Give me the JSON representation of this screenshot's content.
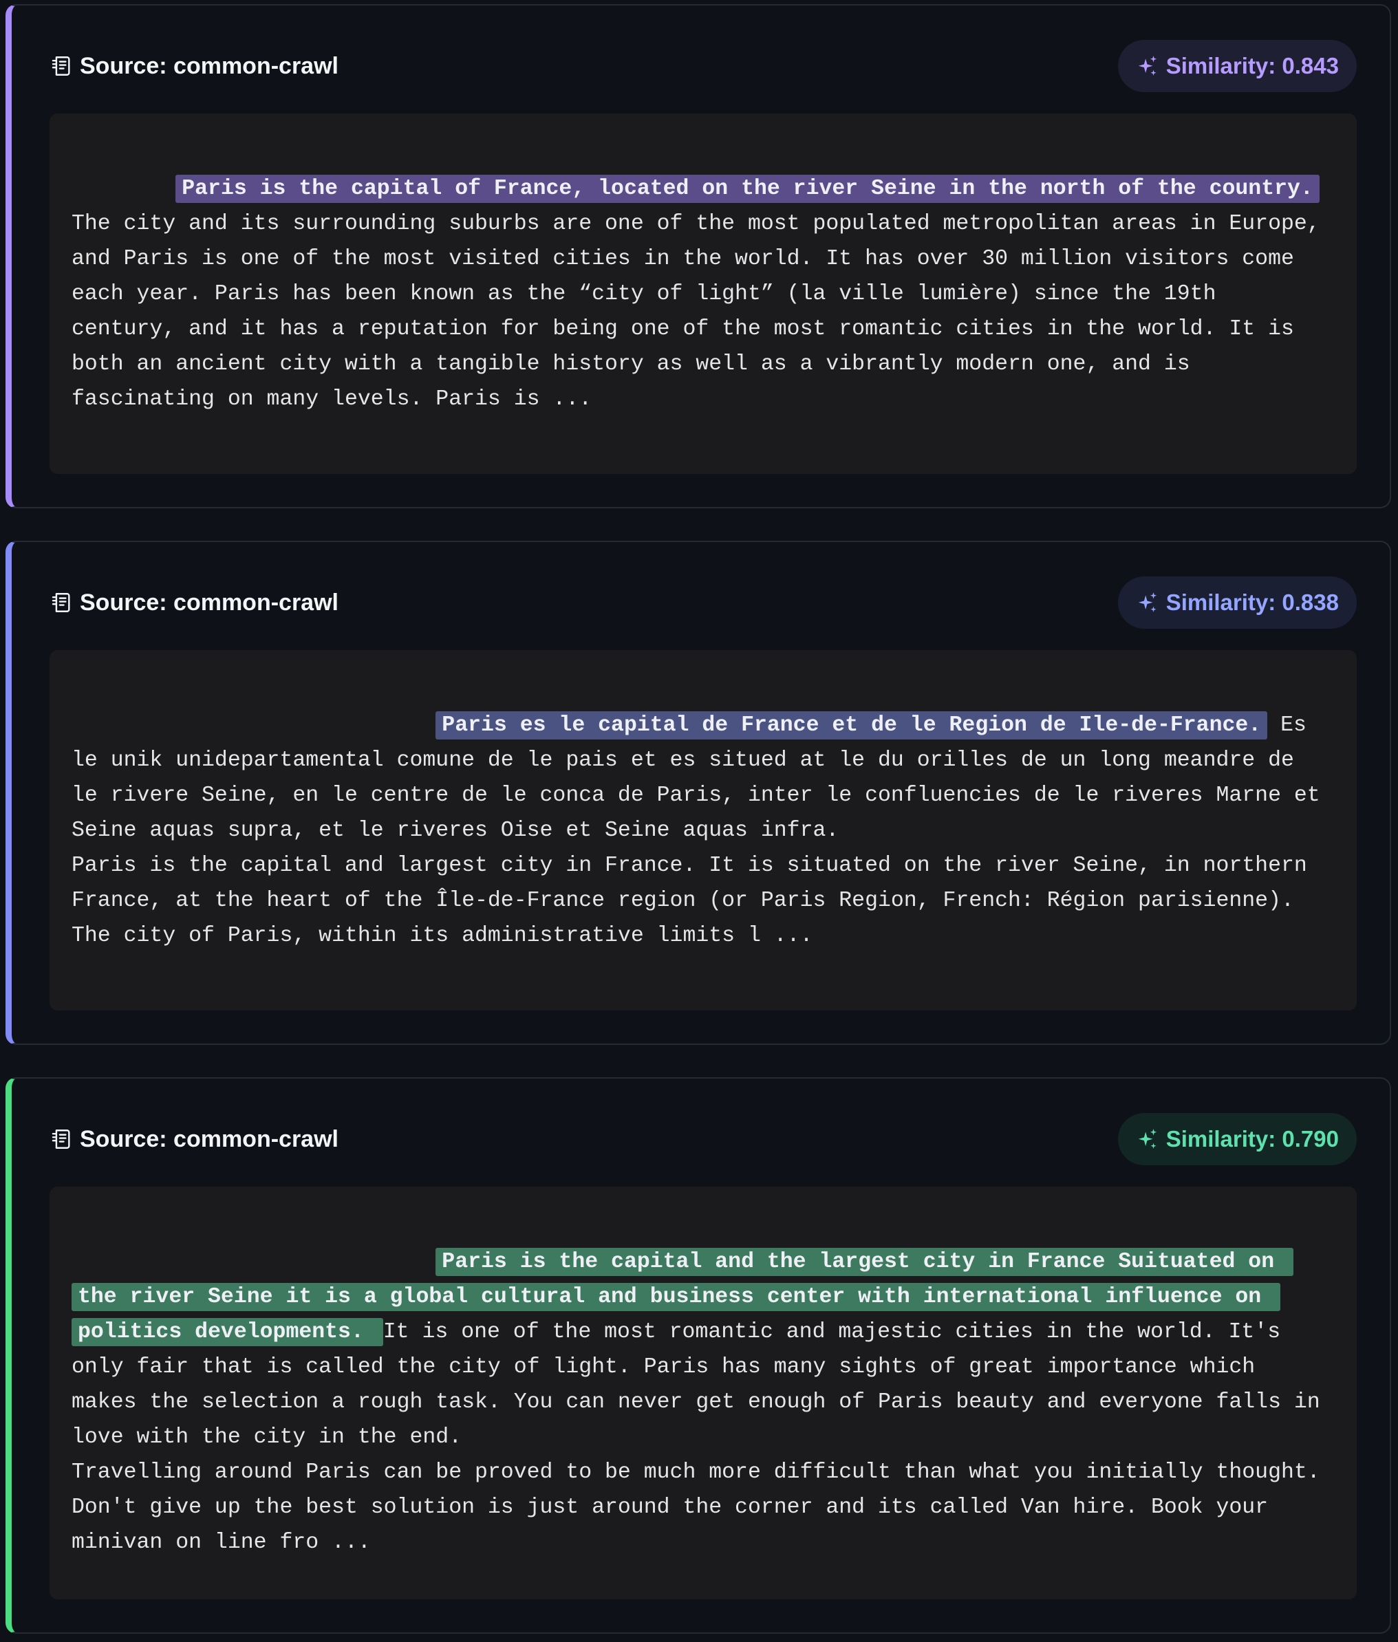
{
  "results": [
    {
      "source_label": "Source: common-crawl",
      "similarity_label": "Similarity: 0.843",
      "similarity": 0.843,
      "accent_color": "#a78bfa",
      "indent": "        ",
      "highlight": "Paris is the capital of France, located on the river Seine in the north of the country.",
      "rest": "\nThe city and its surrounding suburbs are one of the most populated metropolitan areas in Europe,\nand Paris is one of the most visited cities in the world. It has over 30 million visitors come\neach year. Paris has been known as the “city of light” (la ville lumière) since the 19th\ncentury, and it has a reputation for being one of the most romantic cities in the world. It is\nboth an ancient city with a tangible history as well as a vibrantly modern one, and is\nfascinating on many levels. Paris is ..."
    },
    {
      "source_label": "Source: common-crawl",
      "similarity_label": "Similarity: 0.838",
      "similarity": 0.838,
      "accent_color": "#818cf8",
      "indent": "                            ",
      "highlight": "Paris es le capital de France et de le Region de Ile-de-France.",
      "rest": " Es\nle unik unidepartamental comune de le pais et es situed at le du orilles de un long meandre de\nle rivere Seine, en le centre de le conca de Paris, inter le confluencies de le riveres Marne et\nSeine aquas supra, et le riveres Oise et Seine aquas infra.\nParis is the capital and largest city in France. It is situated on the river Seine, in northern\nFrance, at the heart of the Île-de-France region (or Paris Region, French: Région parisienne).\nThe city of Paris, within its administrative limits l ..."
    },
    {
      "source_label": "Source: common-crawl",
      "similarity_label": "Similarity: 0.790",
      "similarity": 0.79,
      "accent_color": "#4ade80",
      "indent": "                            ",
      "highlight": "Paris is the capital and the largest city in France Suituated on \nthe river Seine it is a global cultural and business center with international influence on \npolitics developments. ",
      "rest": "It is one of the most romantic and majestic cities in the world. It's\nonly fair that is called the city of light. Paris has many sights of great importance which\nmakes the selection a rough task. You can never get enough of Paris beauty and everyone falls in\nlove with the city in the end.\nTravelling around Paris can be proved to be much more difficult than what you initially thought.\nDon't give up the best solution is just around the corner and its called Van hire. Book your\nminivan on line fro ..."
    }
  ],
  "icons": {
    "source": "document-icon",
    "similarity": "sparkles-icon"
  }
}
